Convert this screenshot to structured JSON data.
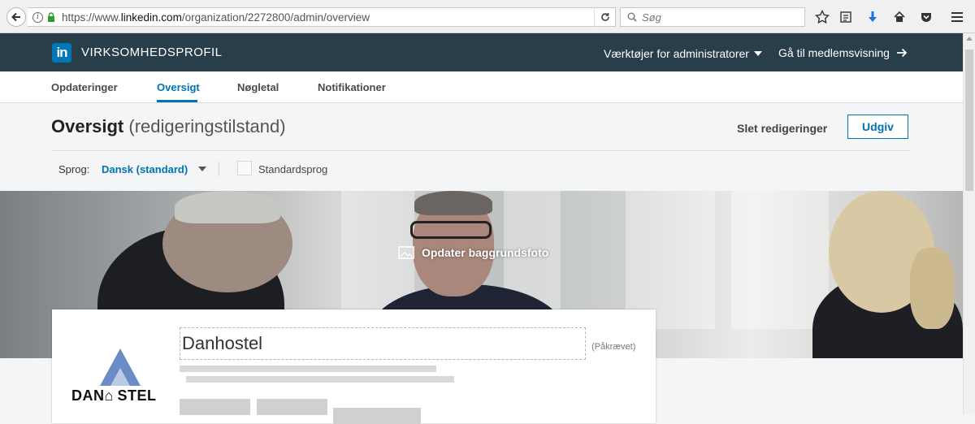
{
  "browser": {
    "url_prefix": "https://www.",
    "url_host": "linkedin.com",
    "url_path": "/organization/2272800/admin/overview",
    "search_placeholder": "Søg"
  },
  "header": {
    "logo_text": "in",
    "brand": "VIRKSOMHEDSPROFIL",
    "admin_tools": "Værktøjer for administratorer",
    "member_view": "Gå til medlemsvisning"
  },
  "tabs": [
    {
      "label": "Opdateringer"
    },
    {
      "label": "Oversigt"
    },
    {
      "label": "Nøgletal"
    },
    {
      "label": "Notifikationer"
    }
  ],
  "active_tab": "Oversigt",
  "page": {
    "title": "Oversigt",
    "subtitle": "(redigeringstilstand)",
    "discard": "Slet redigeringer",
    "publish": "Udgiv"
  },
  "language": {
    "label": "Sprog:",
    "selected": "Dansk (standard)",
    "default_label": "Standardsprog",
    "default_checked": false
  },
  "banner": {
    "cta": "Opdater baggrundsfoto"
  },
  "company": {
    "name": "Danhostel",
    "required_note": "(Påkrævet)",
    "logo_text_left": "DAN",
    "logo_text_right": "STEL"
  },
  "colors": {
    "linkedin_blue": "#0077b5",
    "header_bg": "#283e4a",
    "accent": "#0073b1"
  }
}
